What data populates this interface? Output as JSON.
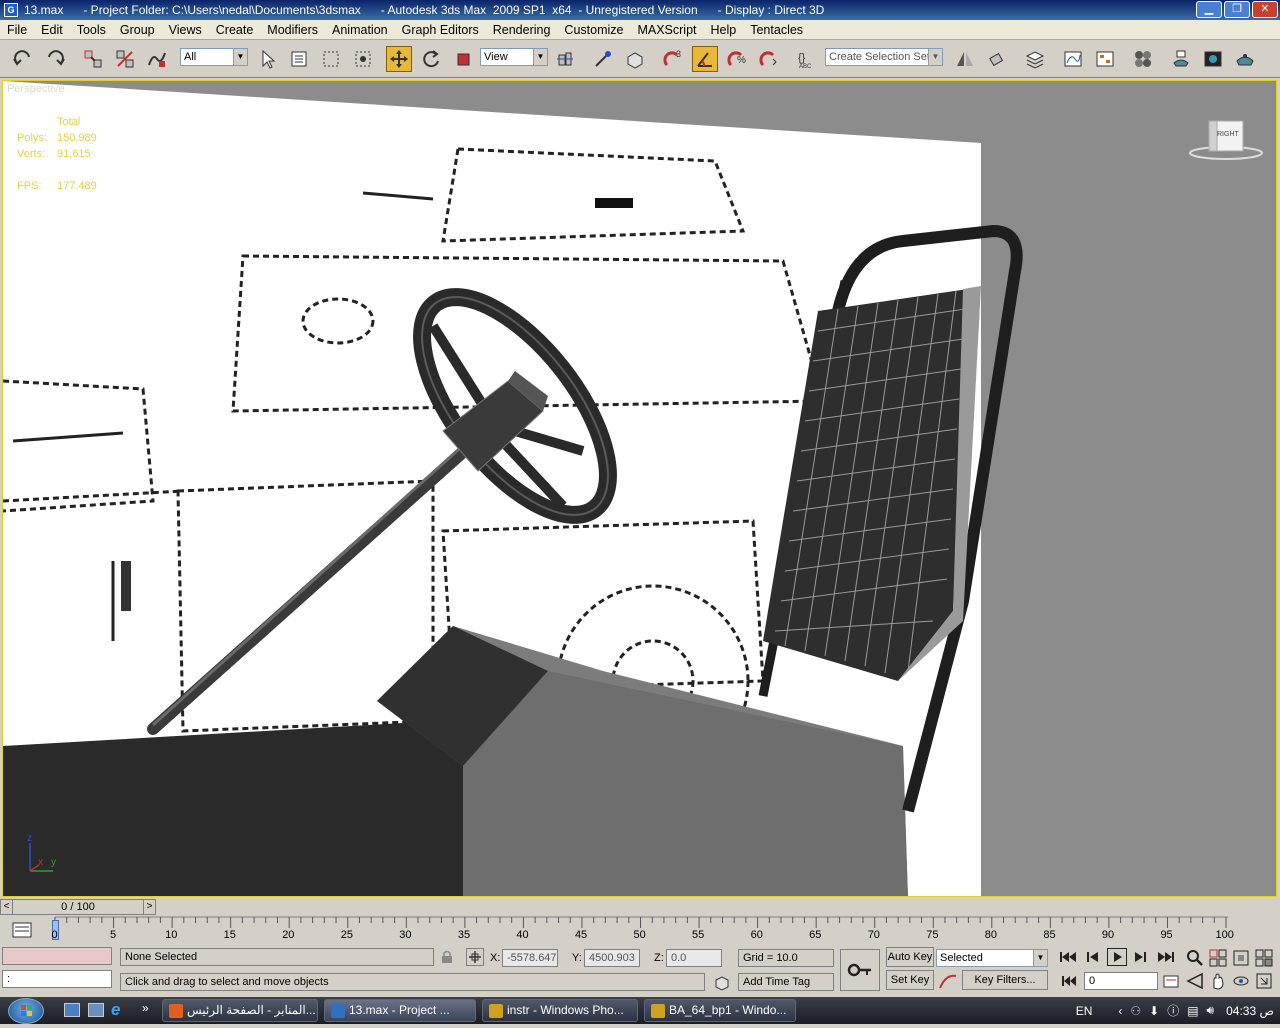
{
  "window": {
    "title": "13.max      - Project Folder: C:\\Users\\nedal\\Documents\\3dsmax      - Autodesk 3ds Max  2009 SP1  x64  - Unregistered Version      - Display : Direct 3D",
    "controls": [
      "minimize",
      "maximize",
      "close"
    ]
  },
  "menu": [
    "File",
    "Edit",
    "Tools",
    "Group",
    "Views",
    "Create",
    "Modifiers",
    "Animation",
    "Graph Editors",
    "Rendering",
    "Customize",
    "MAXScript",
    "Help",
    "Tentacles"
  ],
  "toolbar": {
    "selection_filter": "All",
    "reference_coord": "View",
    "named_selection_placeholder": "Create Selection Set",
    "active_tool": "select-and-move",
    "icons": [
      "undo-icon",
      "redo-icon",
      "link-icon",
      "unlink-icon",
      "bind-space-warp-icon",
      "select-object-icon",
      "select-by-name-icon",
      "rect-selection-region-icon",
      "window-crossing-icon",
      "select-move-icon",
      "select-rotate-icon",
      "select-scale-icon",
      "pivot-center-icon",
      "manipulate-icon",
      "keyboard-shortcut-icon",
      "snap-toggle-icon",
      "angle-snap-icon",
      "percent-snap-icon",
      "spinner-snap-icon",
      "edit-named-selections-icon",
      "mirror-icon",
      "align-icon",
      "layer-manager-icon",
      "curve-editor-icon",
      "schematic-view-icon",
      "material-editor-icon",
      "render-setup-icon",
      "rendered-frame-window-icon",
      "quick-render-icon"
    ]
  },
  "viewport": {
    "label": "Perspective",
    "stats": {
      "header": "Total",
      "polys_label": "Polys:",
      "polys": "150,989",
      "verts_label": "Verts:",
      "verts": "91,615",
      "fps_label": "FPS:",
      "fps": "177.489"
    },
    "viewcube_label": "RIGHT",
    "axis": {
      "z": "z",
      "x": "x",
      "y": "y"
    },
    "colors": {
      "stats": "#e8d040",
      "border": "#e0d020",
      "background": "#8c8c8c"
    }
  },
  "timeline": {
    "slider_text": "0 / 100",
    "ticks": [
      "0",
      "5",
      "10",
      "15",
      "20",
      "25",
      "30",
      "35",
      "40",
      "45",
      "50",
      "55",
      "60",
      "65",
      "70",
      "75",
      "80",
      "85",
      "90",
      "95",
      "100"
    ]
  },
  "status": {
    "selection": "None Selected",
    "prompt": "Click and drag to select and move objects",
    "maxscript_listener": ":",
    "x_label": "X:",
    "x": "-5578.647",
    "y_label": "Y:",
    "y": "4500.903",
    "z_label": "Z:",
    "z": "0.0",
    "grid": "Grid = 10.0",
    "add_time_tag": "Add Time Tag",
    "auto_key": "Auto Key",
    "set_key": "Set Key",
    "key_mode": "Selected",
    "key_filters": "Key Filters...",
    "current_frame": "0"
  },
  "taskbar": {
    "tasks": [
      {
        "label": "المنابر - الصفحة الرئيس...",
        "icon_color": "#e06020"
      },
      {
        "label": "13.max      - Project ...",
        "icon_color": "#3070c0",
        "active": true
      },
      {
        "label": "instr - Windows Pho...",
        "icon_color": "#d0a020"
      },
      {
        "label": "BA_64_bp1 - Windo...",
        "icon_color": "#d0a020"
      }
    ],
    "lang": "EN",
    "time": "04:33 ص"
  }
}
